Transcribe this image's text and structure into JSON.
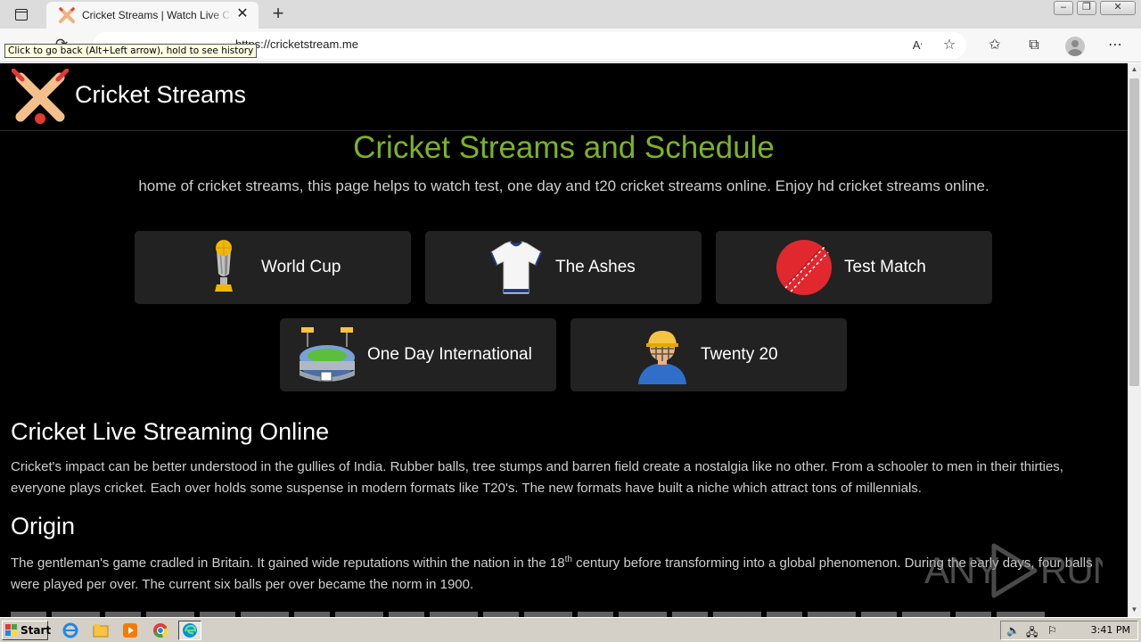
{
  "browser": {
    "tab_title": "Cricket Streams | Watch Live Cricket Streams",
    "url": "https://cricketstream.me",
    "tooltip": "Click to go back (Alt+Left arrow), hold to see history"
  },
  "site": {
    "name": "Cricket Streams",
    "hero_title": "Cricket Streams and Schedule",
    "hero_subtitle": "home of cricket streams, this page helps to watch test, one day and t20 cricket streams online. Enjoy hd cricket streams online.",
    "categories": [
      {
        "label": "World Cup",
        "icon": "trophy-icon"
      },
      {
        "label": "The Ashes",
        "icon": "jersey-icon"
      },
      {
        "label": "Test Match",
        "icon": "cricket-ball-icon"
      },
      {
        "label": "One Day International",
        "icon": "stadium-icon"
      },
      {
        "label": "Twenty 20",
        "icon": "batsman-icon"
      }
    ],
    "sections": [
      {
        "heading": "Cricket Live Streaming Online",
        "body": "Cricket's impact can be better understood in the gullies of India. Rubber balls, tree stumps and barren field create a nostalgia like no other. From a schooler to men in their thirties, everyone plays cricket. Each over holds some suspense in modern formats like T20's. The new formats have built a niche which attract tons of millennials."
      },
      {
        "heading": "Origin",
        "body_before_sup": "The gentleman's game cradled in Britain. It gained wide reputations within the nation in the 18",
        "sup": "th",
        "body_after_sup": " century before transforming into a global phenomenon. During the early days, four balls were played per over. The current six balls per over became the norm in 1900."
      }
    ]
  },
  "watermark": "ANY RUN",
  "taskbar": {
    "start_label": "Start",
    "clock": "3:41 PM"
  }
}
